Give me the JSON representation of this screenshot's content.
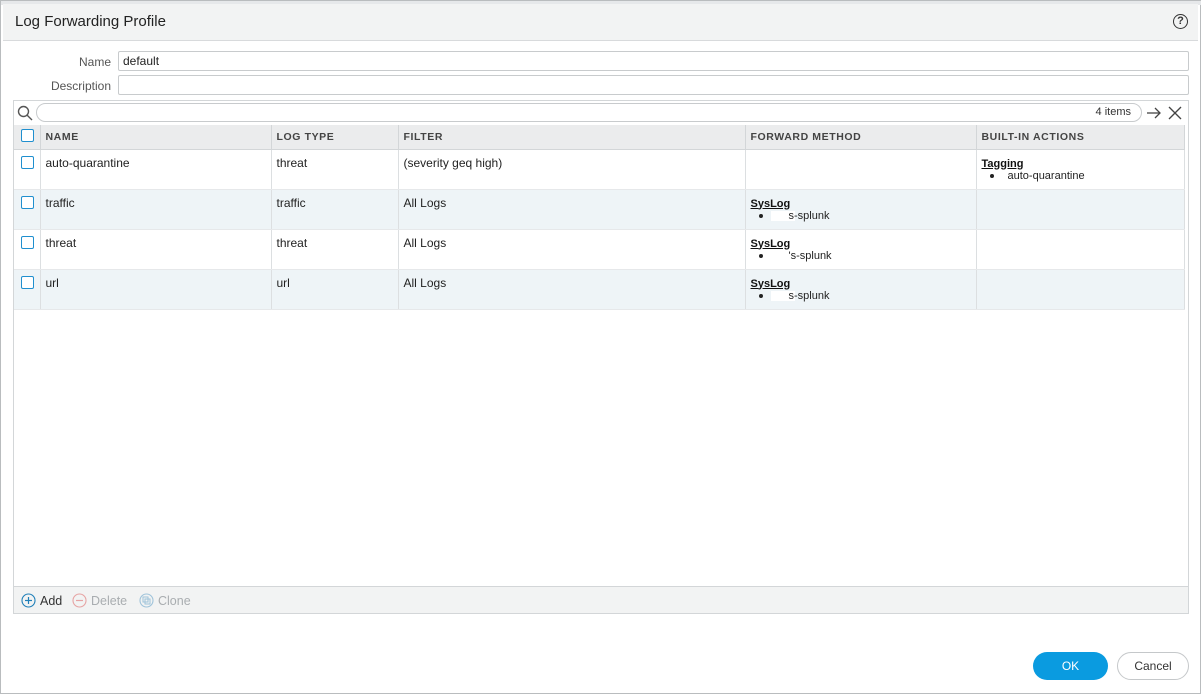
{
  "dialog": {
    "title": "Log Forwarding Profile",
    "help_icon": "?"
  },
  "form": {
    "name_label": "Name",
    "name_value": "default",
    "description_label": "Description",
    "description_value": ""
  },
  "grid": {
    "items_count": "4 items",
    "columns": [
      "NAME",
      "LOG TYPE",
      "FILTER",
      "FORWARD METHOD",
      "BUILT-IN ACTIONS"
    ],
    "rows": [
      {
        "name": "auto-quarantine",
        "log_type": "threat",
        "filter": "(severity geq high)",
        "forward_method_title": "",
        "forward_method_item": "",
        "built_in_title": "Tagging",
        "built_in_item": "auto-quarantine"
      },
      {
        "name": "traffic",
        "log_type": "traffic",
        "filter": "All Logs",
        "forward_method_title": "SysLog",
        "forward_method_item": "s-splunk",
        "built_in_title": "",
        "built_in_item": ""
      },
      {
        "name": "threat",
        "log_type": "threat",
        "filter": "All Logs",
        "forward_method_title": "SysLog",
        "forward_method_item": "'s-splunk",
        "built_in_title": "",
        "built_in_item": ""
      },
      {
        "name": "url",
        "log_type": "url",
        "filter": "All Logs",
        "forward_method_title": "SysLog",
        "forward_method_item": "s-splunk",
        "built_in_title": "",
        "built_in_item": ""
      }
    ]
  },
  "footer": {
    "add_label": "Add",
    "delete_label": "Delete",
    "clone_label": "Clone"
  },
  "buttons": {
    "ok_label": "OK",
    "cancel_label": "Cancel"
  },
  "colors": {
    "accent": "#0a9be0",
    "checkbox": "#1f8fcf",
    "row_alt": "#eef4f7",
    "header_bg": "#ebeced"
  }
}
